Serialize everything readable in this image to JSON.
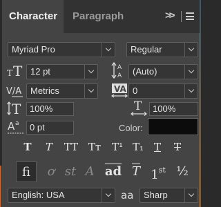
{
  "tabs": {
    "character": "Character",
    "paragraph": "Paragraph",
    "more": ">>"
  },
  "font": {
    "family": "Myriad Pro",
    "style": "Regular"
  },
  "size": {
    "font_size": "12 pt",
    "leading": "(Auto)"
  },
  "spacing": {
    "kerning": "Metrics",
    "tracking": "0"
  },
  "scale": {
    "vertical": "100%",
    "horizontal": "100%"
  },
  "baseline": {
    "shift": "0 pt"
  },
  "color": {
    "label": "Color:",
    "value": "#0c0c0c"
  },
  "format_buttons": {
    "faux_bold": "T",
    "faux_italic": "T",
    "all_caps": "TT",
    "small_caps": "Tт",
    "superscript": "T¹",
    "subscript": "T₁",
    "underline": "T",
    "strikethrough": "T"
  },
  "opentype_buttons": {
    "ligatures": "fi",
    "old_style": "ơ",
    "swash": "st",
    "titling": "A",
    "contextual": "ad",
    "discretionary": "T",
    "ordinals_base": "1",
    "ordinals_sup": "st",
    "fractions": "½"
  },
  "language": {
    "value": "English: USA"
  },
  "antialias": {
    "icon_label": "aa",
    "value": "Sharp"
  }
}
